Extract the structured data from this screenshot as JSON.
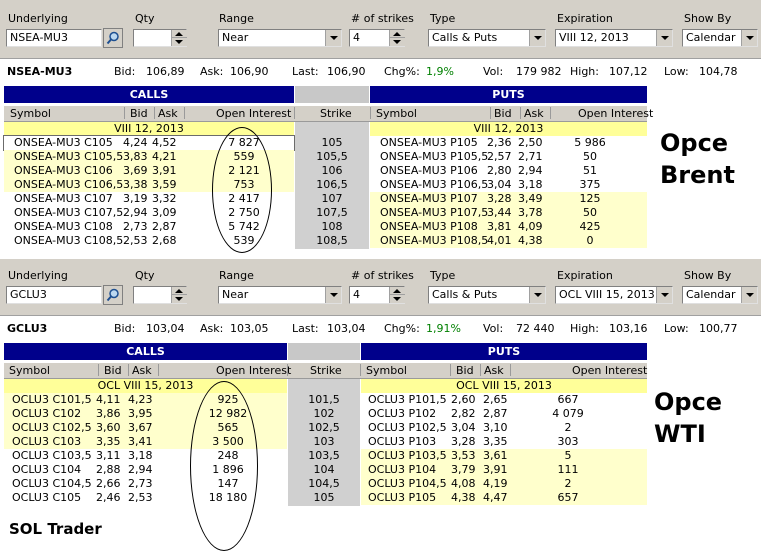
{
  "labels": {
    "underlying": "Underlying",
    "qty": "Qty",
    "range": "Range",
    "strikes": "# of strikes",
    "type": "Type",
    "expiration": "Expiration",
    "show_by": "Show By",
    "bid": "Bid:",
    "ask": "Ask:",
    "last": "Last:",
    "chg": "Chg%:",
    "vol": "Vol:",
    "high": "High:",
    "low": "Low:",
    "calls": "CALLS",
    "puts": "PUTS",
    "symbol": "Symbol",
    "bid_col": "Bid",
    "ask_col": "Ask",
    "open_interest": "Open Interest",
    "strike": "Strike"
  },
  "brent": {
    "controls": {
      "underlying": "NSEA-MU3",
      "qty": "",
      "range": "Near",
      "strikes": "4",
      "type": "Calls & Puts",
      "expiration": "VIII 12, 2013",
      "show_by": "Calendar"
    },
    "quote": {
      "symbol": "NSEA-MU3",
      "bid": "106,89",
      "ask": "106,90",
      "last": "106,90",
      "chg": "1,9%",
      "vol": "179 982",
      "high": "107,12",
      "low": "104,78"
    },
    "expiry_label": "VIII 12, 2013",
    "annotation": [
      "Opce",
      "Brent"
    ],
    "rows": [
      {
        "call_sym": "ONSEA-MU3 C105",
        "call_bid": "4,24",
        "call_ask": "4,52",
        "call_oi": "7 827",
        "strike": "105",
        "put_sym": "ONSEA-MU3 P105",
        "put_bid": "2,36",
        "put_ask": "2,50",
        "put_oi": "5 986",
        "hl_call": false,
        "hl_put": false
      },
      {
        "call_sym": "ONSEA-MU3 C105,5",
        "call_bid": "3,83",
        "call_ask": "4,21",
        "call_oi": "559",
        "strike": "105,5",
        "put_sym": "ONSEA-MU3 P105,5",
        "put_bid": "2,57",
        "put_ask": "2,71",
        "put_oi": "50",
        "hl_call": true,
        "hl_put": false
      },
      {
        "call_sym": "ONSEA-MU3 C106",
        "call_bid": "3,69",
        "call_ask": "3,91",
        "call_oi": "2 121",
        "strike": "106",
        "put_sym": "ONSEA-MU3 P106",
        "put_bid": "2,80",
        "put_ask": "2,94",
        "put_oi": "51",
        "hl_call": true,
        "hl_put": false
      },
      {
        "call_sym": "ONSEA-MU3 C106,5",
        "call_bid": "3,38",
        "call_ask": "3,59",
        "call_oi": "753",
        "strike": "106,5",
        "put_sym": "ONSEA-MU3 P106,5",
        "put_bid": "3,04",
        "put_ask": "3,18",
        "put_oi": "375",
        "hl_call": true,
        "hl_put": false
      },
      {
        "call_sym": "ONSEA-MU3 C107",
        "call_bid": "3,19",
        "call_ask": "3,32",
        "call_oi": "2 417",
        "strike": "107",
        "put_sym": "ONSEA-MU3 P107",
        "put_bid": "3,28",
        "put_ask": "3,49",
        "put_oi": "125",
        "hl_call": false,
        "hl_put": true
      },
      {
        "call_sym": "ONSEA-MU3 C107,5",
        "call_bid": "2,94",
        "call_ask": "3,09",
        "call_oi": "2 750",
        "strike": "107,5",
        "put_sym": "ONSEA-MU3 P107,5",
        "put_bid": "3,44",
        "put_ask": "3,78",
        "put_oi": "50",
        "hl_call": false,
        "hl_put": true
      },
      {
        "call_sym": "ONSEA-MU3 C108",
        "call_bid": "2,73",
        "call_ask": "2,87",
        "call_oi": "5 742",
        "strike": "108",
        "put_sym": "ONSEA-MU3 P108",
        "put_bid": "3,81",
        "put_ask": "4,09",
        "put_oi": "425",
        "hl_call": false,
        "hl_put": true
      },
      {
        "call_sym": "ONSEA-MU3 C108,5",
        "call_bid": "2,53",
        "call_ask": "2,68",
        "call_oi": "539",
        "strike": "108,5",
        "put_sym": "ONSEA-MU3 P108,5",
        "put_bid": "4,01",
        "put_ask": "4,38",
        "put_oi": "0",
        "hl_call": false,
        "hl_put": true
      }
    ]
  },
  "wti": {
    "controls": {
      "underlying": "GCLU3",
      "qty": "",
      "range": "Near",
      "strikes": "4",
      "type": "Calls & Puts",
      "expiration": "OCL VIII 15, 2013",
      "show_by": "Calendar"
    },
    "quote": {
      "symbol": "GCLU3",
      "bid": "103,04",
      "ask": "103,05",
      "last": "103,04",
      "chg": "1,91%",
      "vol": "72 440",
      "high": "103,16",
      "low": "100,77"
    },
    "expiry_label": "OCL VIII 15, 2013",
    "annotation": [
      "Opce",
      "WTI"
    ],
    "footer": "SOL Trader",
    "rows": [
      {
        "call_sym": "OCLU3 C101,5",
        "call_bid": "4,11",
        "call_ask": "4,23",
        "call_oi": "925",
        "strike": "101,5",
        "put_sym": "OCLU3 P101,5",
        "put_bid": "2,60",
        "put_ask": "2,65",
        "put_oi": "667",
        "hl_call": true,
        "hl_put": false
      },
      {
        "call_sym": "OCLU3 C102",
        "call_bid": "3,86",
        "call_ask": "3,95",
        "call_oi": "12 982",
        "strike": "102",
        "put_sym": "OCLU3 P102",
        "put_bid": "2,82",
        "put_ask": "2,87",
        "put_oi": "4 079",
        "hl_call": true,
        "hl_put": false
      },
      {
        "call_sym": "OCLU3 C102,5",
        "call_bid": "3,60",
        "call_ask": "3,67",
        "call_oi": "565",
        "strike": "102,5",
        "put_sym": "OCLU3 P102,5",
        "put_bid": "3,04",
        "put_ask": "3,10",
        "put_oi": "2",
        "hl_call": true,
        "hl_put": false
      },
      {
        "call_sym": "OCLU3 C103",
        "call_bid": "3,35",
        "call_ask": "3,41",
        "call_oi": "3 500",
        "strike": "103",
        "put_sym": "OCLU3 P103",
        "put_bid": "3,28",
        "put_ask": "3,35",
        "put_oi": "303",
        "hl_call": true,
        "hl_put": false
      },
      {
        "call_sym": "OCLU3 C103,5",
        "call_bid": "3,11",
        "call_ask": "3,18",
        "call_oi": "248",
        "strike": "103,5",
        "put_sym": "OCLU3 P103,5",
        "put_bid": "3,53",
        "put_ask": "3,61",
        "put_oi": "5",
        "hl_call": false,
        "hl_put": true
      },
      {
        "call_sym": "OCLU3 C104",
        "call_bid": "2,88",
        "call_ask": "2,94",
        "call_oi": "1 896",
        "strike": "104",
        "put_sym": "OCLU3 P104",
        "put_bid": "3,79",
        "put_ask": "3,91",
        "put_oi": "111",
        "hl_call": false,
        "hl_put": true
      },
      {
        "call_sym": "OCLU3 C104,5",
        "call_bid": "2,66",
        "call_ask": "2,73",
        "call_oi": "147",
        "strike": "104,5",
        "put_sym": "OCLU3 P104,5",
        "put_bid": "4,08",
        "put_ask": "4,19",
        "put_oi": "2",
        "hl_call": false,
        "hl_put": true
      },
      {
        "call_sym": "OCLU3 C105",
        "call_bid": "2,46",
        "call_ask": "2,53",
        "call_oi": "18 180",
        "strike": "105",
        "put_sym": "OCLU3 P105",
        "put_bid": "4,38",
        "put_ask": "4,47",
        "put_oi": "657",
        "hl_call": false,
        "hl_put": true
      }
    ]
  }
}
